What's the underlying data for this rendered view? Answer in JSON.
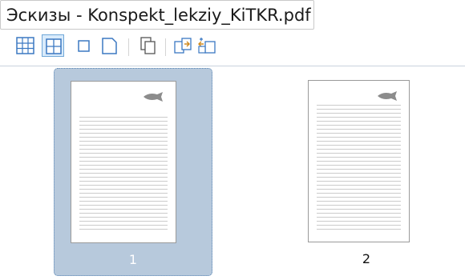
{
  "window": {
    "title": "Эскизы - Konspekt_lekziy_KiTKR.pdf"
  },
  "toolbar": {
    "buttons": [
      {
        "icon": "grid-small-icon",
        "active": false
      },
      {
        "icon": "grid-large-icon",
        "active": true
      },
      {
        "icon": "page-small-icon",
        "active": false
      },
      {
        "icon": "page-large-icon",
        "active": false
      },
      {
        "icon": "copy-pages-icon",
        "active": false
      },
      {
        "icon": "extract-page-icon",
        "active": false
      },
      {
        "icon": "insert-page-icon",
        "active": false
      }
    ]
  },
  "thumbnails": [
    {
      "number": "1",
      "selected": true
    },
    {
      "number": "2",
      "selected": false
    }
  ],
  "colors": {
    "selection": "#b7c9dc",
    "active_button_bg": "#d9ebfb",
    "active_button_border": "#6fa7d8",
    "icon_blue": "#3b78c2"
  }
}
